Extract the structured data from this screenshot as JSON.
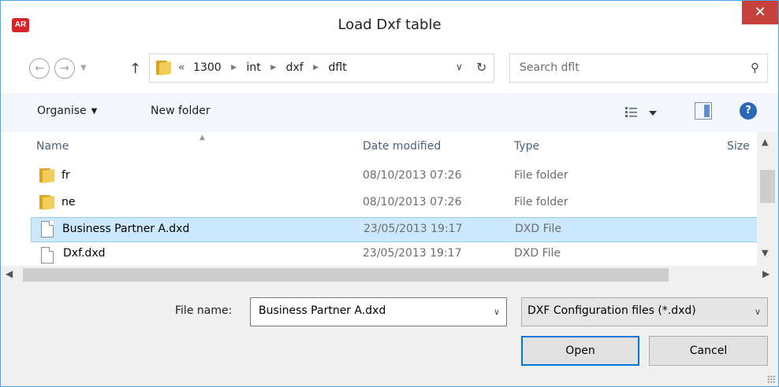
{
  "window": {
    "app_icon_text": "AR",
    "title": "Load Dxf table",
    "close_glyph": "✕"
  },
  "address": {
    "overflow": "«",
    "crumbs": [
      "1300",
      "int",
      "dxf",
      "dflt"
    ],
    "search_placeholder": "Search dflt"
  },
  "toolbar": {
    "organise_label": "Organise",
    "new_folder_label": "New folder"
  },
  "file_list": {
    "columns": [
      "Name",
      "Date modified",
      "Type",
      "Size"
    ],
    "rows": [
      {
        "name": "fr",
        "date": "08/10/2013 07:26",
        "type": "File folder",
        "icon": "folder-icon"
      },
      {
        "name": "ne",
        "date": "08/10/2013 07:26",
        "type": "File folder",
        "icon": "folder-icon"
      },
      {
        "name": "Business Partner A.dxd",
        "date": "23/05/2013 19:17",
        "type": "DXD File",
        "icon": "file-icon",
        "selected": true
      },
      {
        "name": "Dxf.dxd",
        "date": "23/05/2013 19:17",
        "type": "DXD File",
        "icon": "file-icon"
      }
    ]
  },
  "bottom": {
    "file_name_label": "File name:",
    "file_name_value": "Business Partner A.dxd",
    "filter_value": "DXF Configuration files (*.dxd)",
    "open_label": "Open",
    "cancel_label": "Cancel"
  },
  "colors": {
    "selection": "#cce8ff",
    "close_button": "#c7413c",
    "accent": "#0078d7"
  }
}
